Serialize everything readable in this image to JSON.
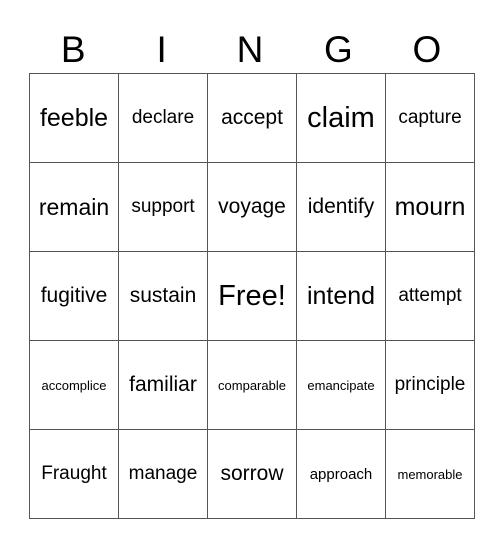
{
  "header": [
    "B",
    "I",
    "N",
    "G",
    "O"
  ],
  "rows": [
    [
      "feeble",
      "declare",
      "accept",
      "claim",
      "capture"
    ],
    [
      "remain",
      "support",
      "voyage",
      "identify",
      "mourn"
    ],
    [
      "fugitive",
      "sustain",
      "Free!",
      "intend",
      "attempt"
    ],
    [
      "accomplice",
      "familiar",
      "comparable",
      "emancipate",
      "principle"
    ],
    [
      "Fraught",
      "manage",
      "sorrow",
      "approach",
      "memorable"
    ]
  ]
}
